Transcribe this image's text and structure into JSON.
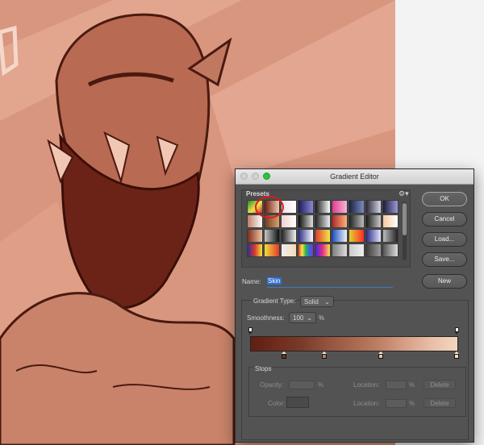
{
  "window": {
    "title": "Gradient Editor"
  },
  "presets": {
    "label": "Presets",
    "gear_icon": "gear-icon",
    "swatches": [
      "linear-gradient(135deg,#1e8a2e,#f1e64a 55%,#d32b2b)",
      "linear-gradient(90deg,#6b1d10,#f2c7a9)",
      "linear-gradient(90deg,#e9e4ea,#ffffff)",
      "linear-gradient(90deg,#1d1b58,#8b88d8)",
      "linear-gradient(90deg,#1a1a1a,#ffffff)",
      "linear-gradient(90deg,#e03d8f,#f7b6d8)",
      "linear-gradient(90deg,#1b2340,#7b8bc2)",
      "linear-gradient(90deg,#2a2a3a,#d8d8e8)",
      "linear-gradient(90deg,#1d1d3a,#9a9ad8)",
      "linear-gradient(90deg,#c27d66,#ffffff)",
      "linear-gradient(90deg,#6b3b21,#d8a06b)",
      "linear-gradient(90deg,#f1d0cc,#ffffff)",
      "linear-gradient(90deg,#0c0c0c,#e0e0e0)",
      "linear-gradient(90deg,#262626,#f0f0f0)",
      "linear-gradient(90deg,#b12a2a,#ffb17a)",
      "linear-gradient(90deg,#222,#bbb)",
      "linear-gradient(90deg,#1a1a1a,#cccccc)",
      "linear-gradient(90deg,#f7c9a2,#ffffff)",
      "linear-gradient(90deg,#7d2d1c,#f3c4a4)",
      "linear-gradient(90deg,#c8c8c8,#111)",
      "linear-gradient(90deg,#222,#f2f2f2)",
      "linear-gradient(90deg,#2c2d8a,#ffffff)",
      "linear-gradient(90deg,#d93b2b,#f5e94f)",
      "linear-gradient(90deg,#1c52c7,#f2f2f2)",
      "linear-gradient(90deg,#e3d12b,#ff2b2b)",
      "linear-gradient(90deg,#2b2b8a,#e5e5ff)",
      "linear-gradient(90deg,#bbbbbb,#222222)",
      "linear-gradient(90deg,#2d2d9c,#d83b2b,#f6e73b)",
      "linear-gradient(90deg,#f2dd3d,#df3b2b)",
      "linear-gradient(90deg,#eeeeee,#f7d9b8)",
      "linear-gradient(90deg,#e83b2b,#f8e54a,#33b34a,#2b6fd9,#8d2bd9)",
      "linear-gradient(90deg,#3b2bd9,#e52b8d,#f8e54a)",
      "linear-gradient(90deg,#7e7e7e,#dcdcdc)",
      "linear-gradient(90deg,#cccccc,#eeeeee)",
      "linear-gradient(90deg,#3c3c3c,#9e9e9e)",
      "linear-gradient(90deg,#555,#ddd)"
    ]
  },
  "buttons": {
    "ok": "OK",
    "cancel": "Cancel",
    "load": "Load...",
    "save": "Save...",
    "new": "New"
  },
  "name": {
    "label": "Name:",
    "value": "Skin"
  },
  "gradient_type": {
    "label": "Gradient Type:",
    "value": "Solid"
  },
  "smoothness": {
    "label": "Smoothness:",
    "value": "100",
    "unit": "%"
  },
  "gradient_bar": {
    "colors": [
      "#5f1f12",
      "#702c1c",
      "#7a3b2a",
      "#94543f",
      "#a9684f",
      "#be8066",
      "#d6a088",
      "#e8bea6",
      "#f4d7c0"
    ],
    "color_stops": [
      "#7a2c1c",
      "#c27a60",
      "#efb79c",
      "#f7d7c1"
    ]
  },
  "stops": {
    "label": "Stops",
    "opacity_label": "Opacity:",
    "opacity_unit": "%",
    "location_label": "Location:",
    "location_unit": "%",
    "color_label": "Color:",
    "delete_label": "Delete"
  }
}
